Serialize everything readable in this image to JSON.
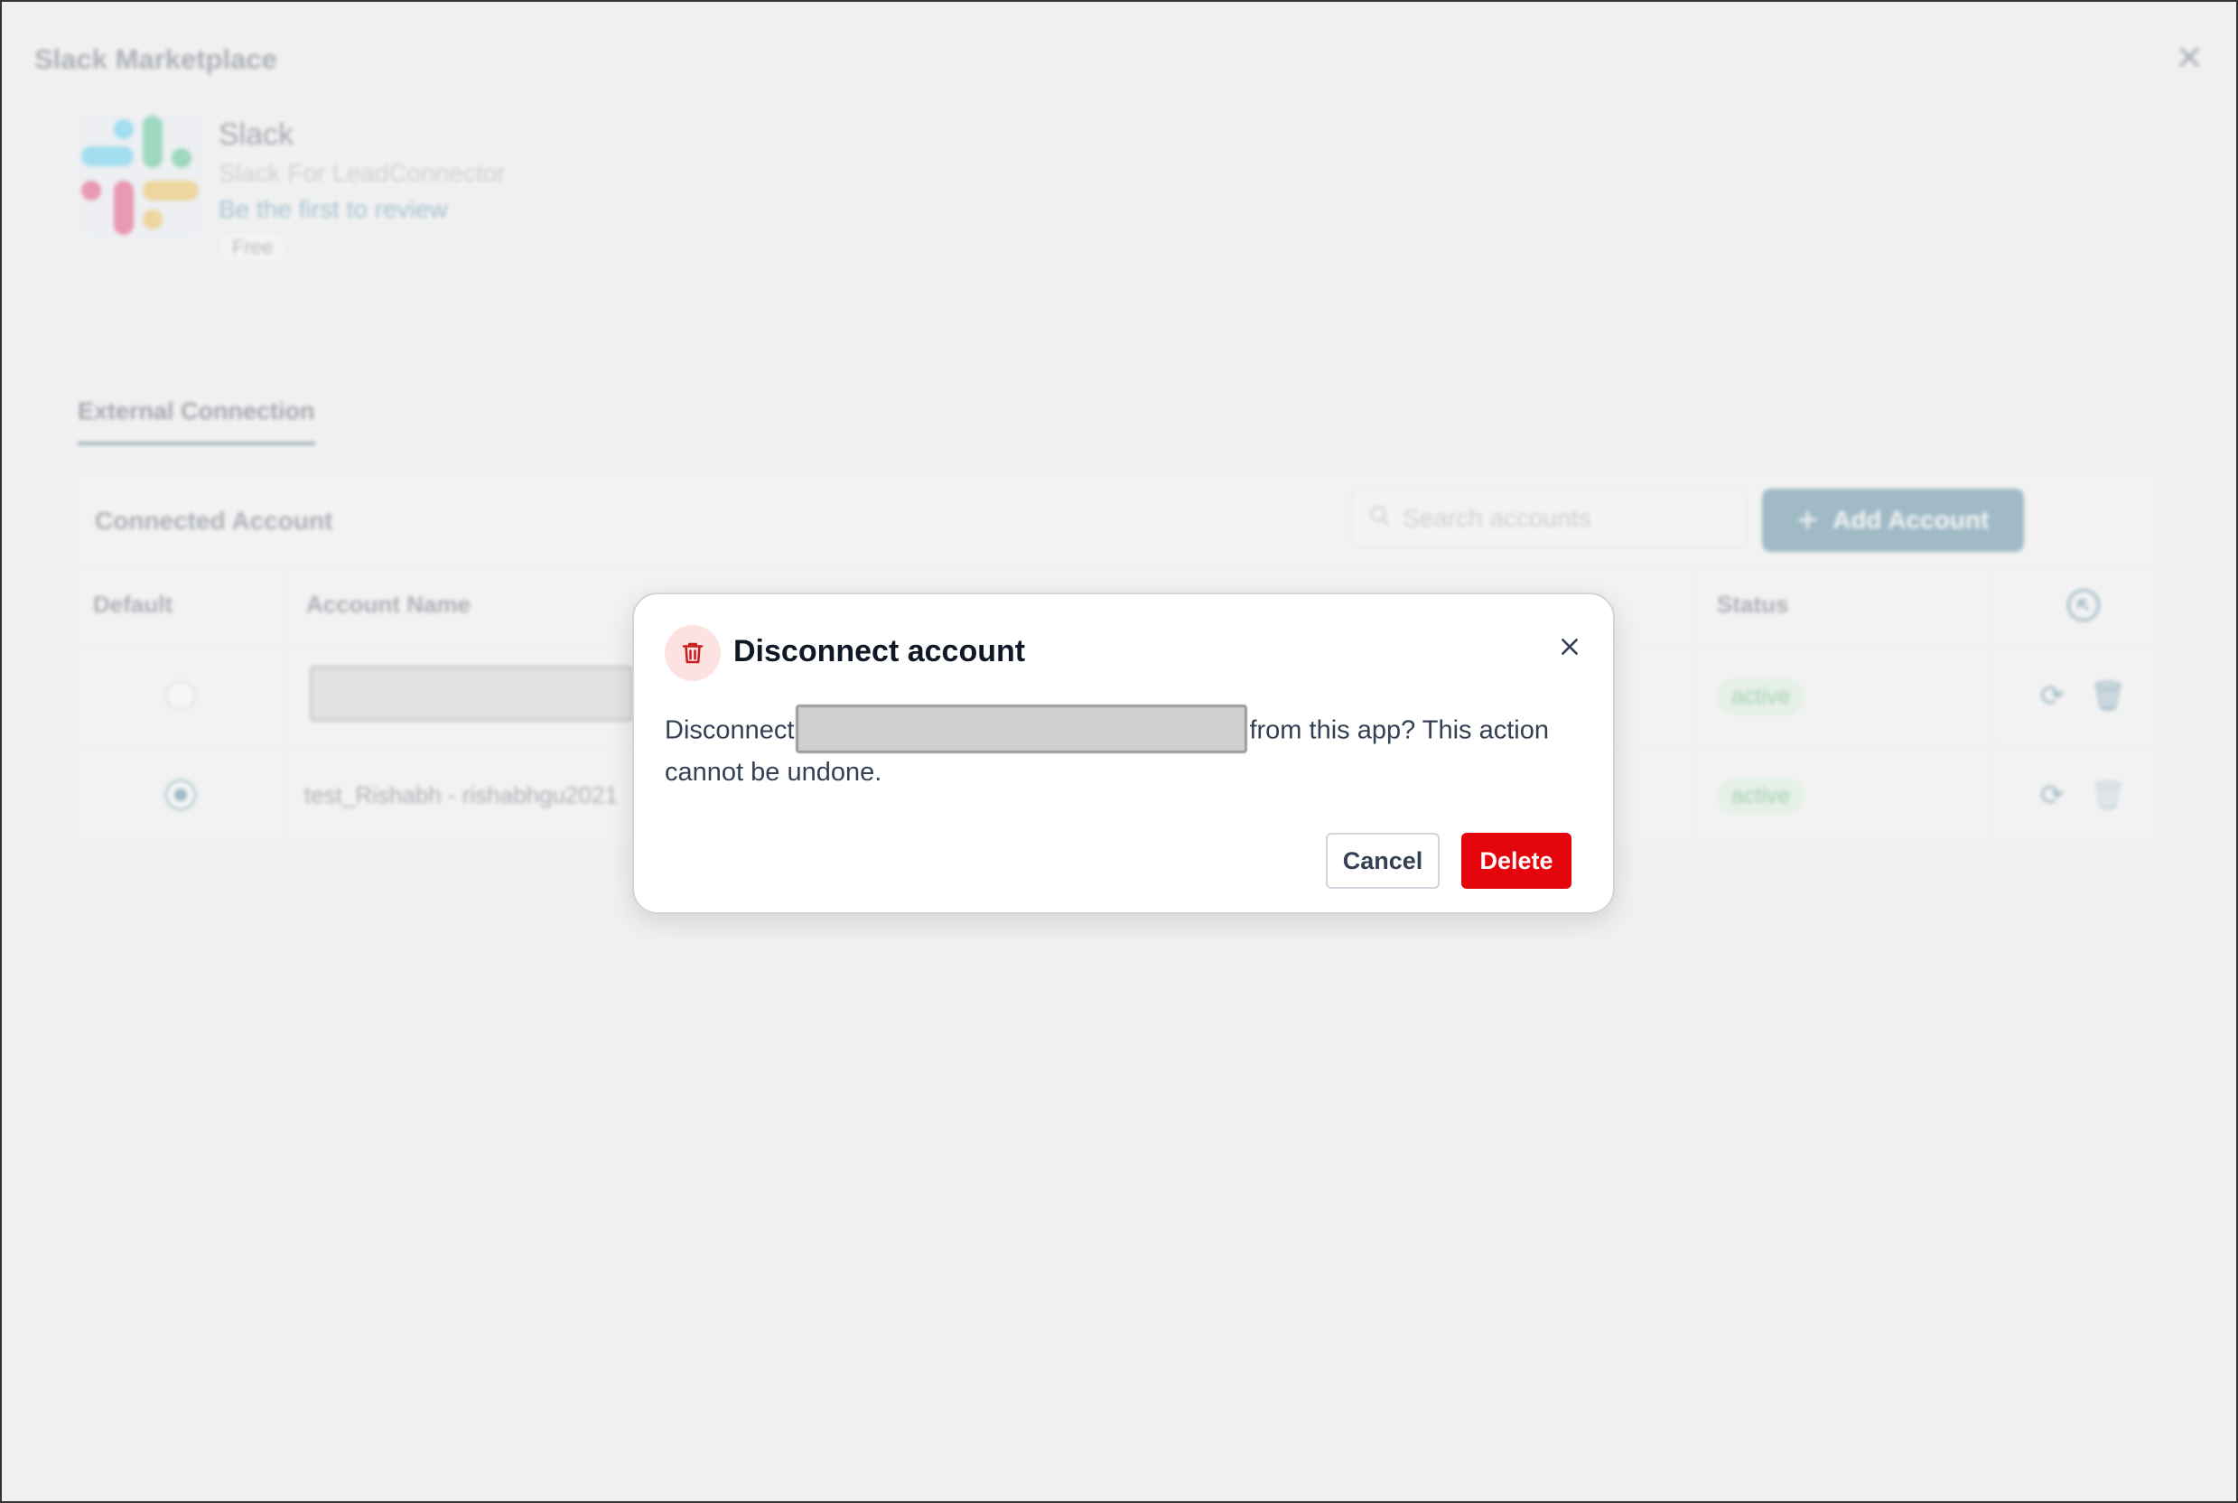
{
  "window": {
    "title": "Slack Marketplace"
  },
  "app": {
    "name": "Slack",
    "subtitle": "Slack For LeadConnector",
    "review_link": "Be the first to review",
    "price_badge": "Free"
  },
  "tabs": [
    {
      "label": "External Connection",
      "active": true
    }
  ],
  "accounts_panel": {
    "title": "Connected Account",
    "search_placeholder": "Search accounts",
    "add_button_label": "Add Account",
    "columns": {
      "default": "Default",
      "account_name": "Account Name",
      "status": "Status"
    },
    "rows": [
      {
        "default": false,
        "account_name": "",
        "status": "active"
      },
      {
        "default": true,
        "account_name": "test_Rishabh - rishabhgu2021",
        "status": "active"
      }
    ]
  },
  "modal": {
    "title": "Disconnect account",
    "body_prefix": "Disconnect",
    "body_suffix": "from this app? This action cannot be undone.",
    "cancel_label": "Cancel",
    "delete_label": "Delete"
  },
  "colors": {
    "danger": "#e5050c",
    "danger_soft": "#fde2e2",
    "accent": "#2f6f8c",
    "status_active": "#3aa35a"
  },
  "icons": {
    "modal_icon": "trash-icon",
    "close": "close-icon",
    "refresh": "refresh-icon",
    "delete_row": "trash-icon",
    "search": "search-icon",
    "add": "plus-icon"
  }
}
